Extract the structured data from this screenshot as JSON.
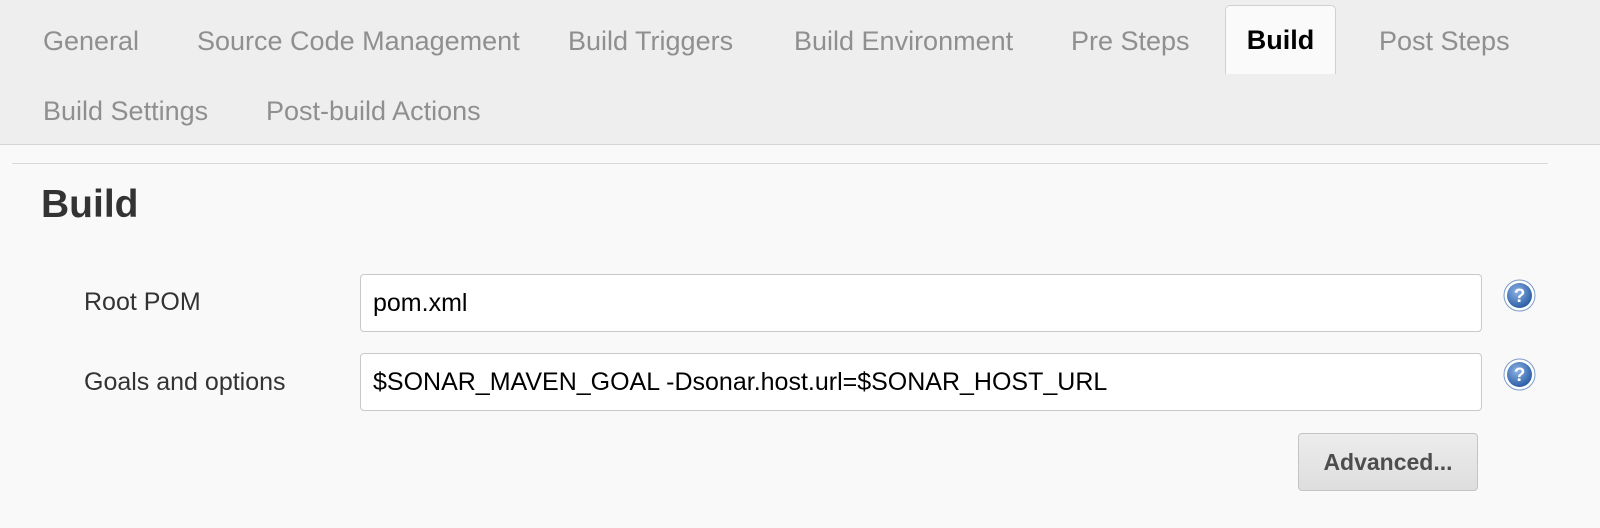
{
  "tabs": [
    {
      "label": "General",
      "active": false
    },
    {
      "label": "Source Code Management",
      "active": false
    },
    {
      "label": "Build Triggers",
      "active": false
    },
    {
      "label": "Build Environment",
      "active": false
    },
    {
      "label": "Pre Steps",
      "active": false
    },
    {
      "label": "Build",
      "active": true
    },
    {
      "label": "Post Steps",
      "active": false
    },
    {
      "label": "Build Settings",
      "active": false
    },
    {
      "label": "Post-build Actions",
      "active": false
    }
  ],
  "section": {
    "title": "Build"
  },
  "fields": {
    "root_pom": {
      "label": "Root POM",
      "value": "pom.xml",
      "help_icon": "question-mark-icon"
    },
    "goals": {
      "label": "Goals and options",
      "value": "$SONAR_MAVEN_GOAL -Dsonar.host.url=$SONAR_HOST_URL",
      "help_icon": "question-mark-icon"
    }
  },
  "buttons": {
    "advanced_label": "Advanced..."
  },
  "colors": {
    "tab_bar_bg": "#eeeeee",
    "inactive_tab_text": "#8f8f8f",
    "help_icon_blue": "#3b72b8"
  }
}
